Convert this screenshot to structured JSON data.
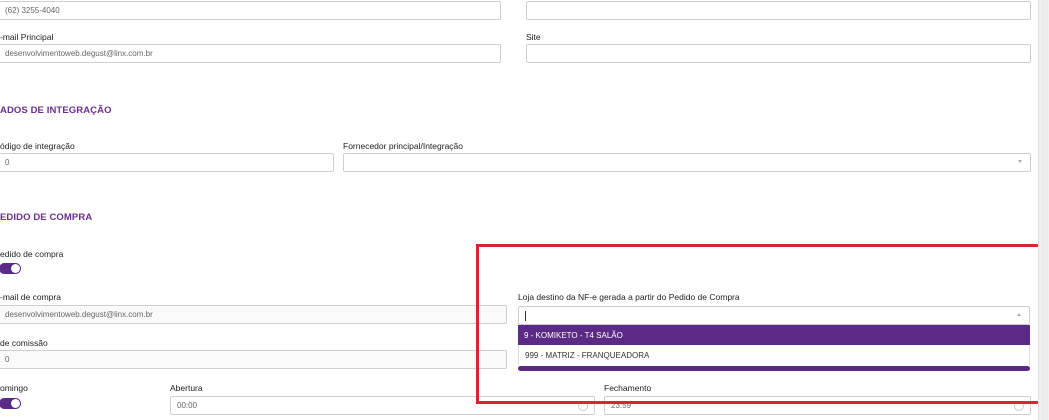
{
  "contact": {
    "phone_value": "(62) 3255-4040",
    "email_label": "-mail Principal",
    "email_value": "desenvolvimentoweb.degust@linx.com.br",
    "site_label": "Site",
    "site_value": ""
  },
  "integration": {
    "title": "ADOS DE INTEGRAÇÃO",
    "code_label": "ódigo de integração",
    "code_value": "0",
    "supplier_label": "Fornecedor principal/Integração",
    "supplier_value": ""
  },
  "purchase": {
    "title": "EDIDO DE COMPRA",
    "order_label": "edido de compra",
    "order_enabled": true,
    "email_label": "-mail de compra",
    "email_value": "desenvolvimentoweb.degust@linx.com.br",
    "commission_label": "de comissão",
    "commission_value": "0",
    "store_label": "Loja destino da NF-e gerada a partir do Pedido de Compra",
    "store_value": "",
    "store_options": [
      "9 - KOMIKETO - T4 SALÃO",
      "999 - MATRIZ - FRANQUEADORA"
    ],
    "store_selected_index": 0
  },
  "hours": {
    "day_label": "omingo",
    "day_enabled": true,
    "open_label": "Abertura",
    "open_value": "00:00",
    "close_label": "Fechamento",
    "close_value": "23:59"
  },
  "colors": {
    "accent": "#5b2a86",
    "section_title": "#6b2f8e",
    "highlight_border": "#d9262e"
  }
}
